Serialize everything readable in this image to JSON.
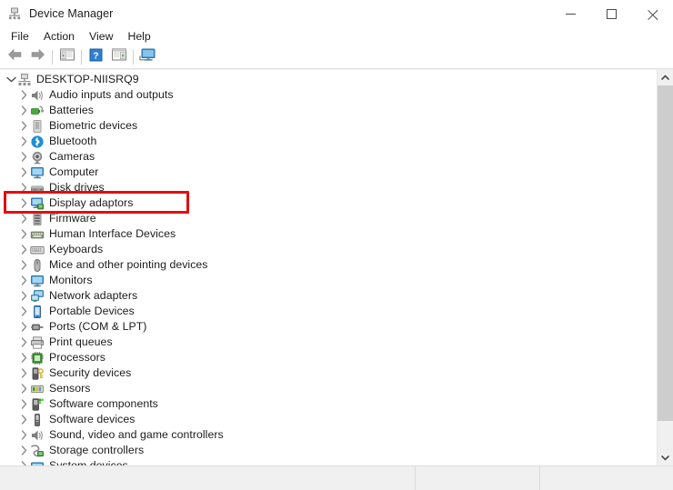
{
  "window": {
    "title": "Device Manager",
    "icon": "device-manager-icon",
    "buttons": {
      "minimize": "—",
      "maximize": "□",
      "close": "✕"
    }
  },
  "menubar": {
    "items": [
      {
        "label": "File"
      },
      {
        "label": "Action"
      },
      {
        "label": "View"
      },
      {
        "label": "Help"
      }
    ]
  },
  "toolbar": {
    "buttons": [
      {
        "name": "back-button",
        "icon": "back-arrow-icon"
      },
      {
        "name": "forward-button",
        "icon": "forward-arrow-icon"
      },
      {
        "name": "separator-1",
        "icon": "separator"
      },
      {
        "name": "show-hide-console-tree-button",
        "icon": "console-tree-icon"
      },
      {
        "name": "separator-2",
        "icon": "separator"
      },
      {
        "name": "help-button",
        "icon": "help-question-icon"
      },
      {
        "name": "properties-button",
        "icon": "properties-window-icon"
      },
      {
        "name": "separator-3",
        "icon": "separator"
      },
      {
        "name": "scan-for-hardware-changes-button",
        "icon": "monitor-scan-icon"
      }
    ]
  },
  "tree": {
    "root": {
      "label": "DESKTOP-NIISRQ9",
      "icon": "computer-root-icon",
      "expanded": true
    },
    "items": [
      {
        "label": "Audio inputs and outputs",
        "icon": "speaker-icon",
        "highlighted": false
      },
      {
        "label": "Batteries",
        "icon": "battery-icon",
        "highlighted": false
      },
      {
        "label": "Biometric devices",
        "icon": "fingerprint-icon",
        "highlighted": false
      },
      {
        "label": "Bluetooth",
        "icon": "bluetooth-icon",
        "highlighted": false
      },
      {
        "label": "Cameras",
        "icon": "camera-icon",
        "highlighted": false
      },
      {
        "label": "Computer",
        "icon": "monitor-icon",
        "highlighted": false
      },
      {
        "label": "Disk drives",
        "icon": "disk-drive-icon",
        "highlighted": false
      },
      {
        "label": "Display adaptors",
        "icon": "display-adapter-icon",
        "highlighted": true
      },
      {
        "label": "Firmware",
        "icon": "firmware-icon",
        "highlighted": false
      },
      {
        "label": "Human Interface Devices",
        "icon": "hid-icon",
        "highlighted": false
      },
      {
        "label": "Keyboards",
        "icon": "keyboard-icon",
        "highlighted": false
      },
      {
        "label": "Mice and other pointing devices",
        "icon": "mouse-icon",
        "highlighted": false
      },
      {
        "label": "Monitors",
        "icon": "monitor-icon",
        "highlighted": false
      },
      {
        "label": "Network adapters",
        "icon": "network-adapter-icon",
        "highlighted": false
      },
      {
        "label": "Portable Devices",
        "icon": "portable-device-icon",
        "highlighted": false
      },
      {
        "label": "Ports (COM & LPT)",
        "icon": "port-icon",
        "highlighted": false
      },
      {
        "label": "Print queues",
        "icon": "printer-icon",
        "highlighted": false
      },
      {
        "label": "Processors",
        "icon": "processor-icon",
        "highlighted": false
      },
      {
        "label": "Security devices",
        "icon": "security-device-icon",
        "highlighted": false
      },
      {
        "label": "Sensors",
        "icon": "sensor-icon",
        "highlighted": false
      },
      {
        "label": "Software components",
        "icon": "software-component-icon",
        "highlighted": false
      },
      {
        "label": "Software devices",
        "icon": "software-device-icon",
        "highlighted": false
      },
      {
        "label": "Sound, video and game controllers",
        "icon": "sound-video-icon",
        "highlighted": false
      },
      {
        "label": "Storage controllers",
        "icon": "storage-controller-icon",
        "highlighted": false
      },
      {
        "label": "System devices",
        "icon": "system-device-icon",
        "highlighted": false
      }
    ]
  },
  "scrollbar": {
    "up_arrow": "∧",
    "down_arrow": "∨"
  },
  "statusbar": {
    "main": "",
    "segment_2": "",
    "segment_3": ""
  },
  "colors": {
    "highlight": "#e01010",
    "accent_blue": "#2f8fd8",
    "accent_green": "#4aa83c"
  }
}
